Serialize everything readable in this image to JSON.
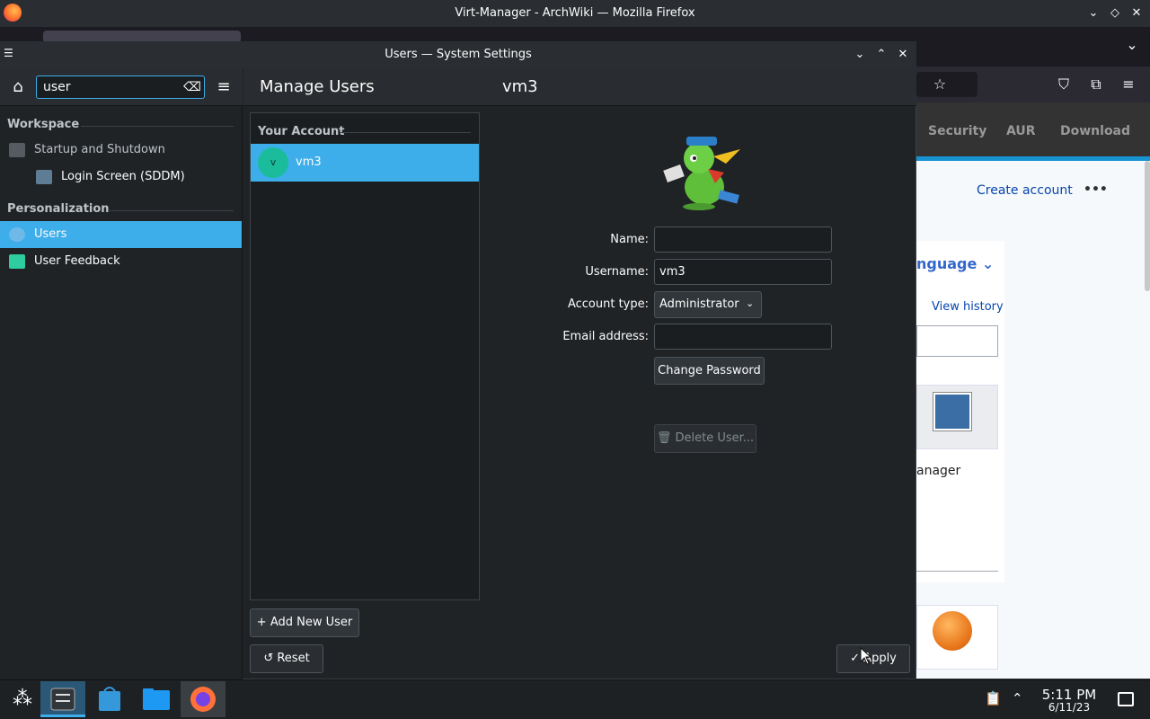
{
  "firefox": {
    "title": "Virt-Manager - ArchWiki — Mozilla Firefox",
    "wiki_nav": [
      "Security",
      "AUR",
      "Download"
    ],
    "create_account": "Create account",
    "more": "•••",
    "language_partial": "nguage",
    "view_history": "View history",
    "manager_partial": "anager"
  },
  "window": {
    "title": "Users — System Settings"
  },
  "sidebar": {
    "search_value": "user",
    "categories": [
      {
        "label": "Workspace",
        "items": [
          {
            "label": "Startup and Shutdown"
          },
          {
            "label": "Login Screen (SDDM)"
          }
        ]
      },
      {
        "label": "Personalization",
        "items": [
          {
            "label": "Users"
          },
          {
            "label": "User Feedback"
          }
        ]
      }
    ]
  },
  "main": {
    "page_title": "Manage Users",
    "selected_user_title": "vm3",
    "list_section": "Your Account",
    "users": [
      {
        "initial": "v",
        "name": "vm3"
      }
    ],
    "form": {
      "name_label": "Name:",
      "name_value": "",
      "username_label": "Username:",
      "username_value": "vm3",
      "account_type_label": "Account type:",
      "account_type_value": "Administrator",
      "email_label": "Email address:",
      "email_value": "",
      "change_password": "Change Password",
      "delete_user": "Delete User..."
    },
    "add_new_user": "Add New User",
    "reset": "Reset",
    "apply": "Apply"
  },
  "taskbar": {
    "time": "5:11 PM",
    "date": "6/11/23"
  },
  "colors": {
    "accent": "#3daee9",
    "window_bg": "#202326"
  }
}
